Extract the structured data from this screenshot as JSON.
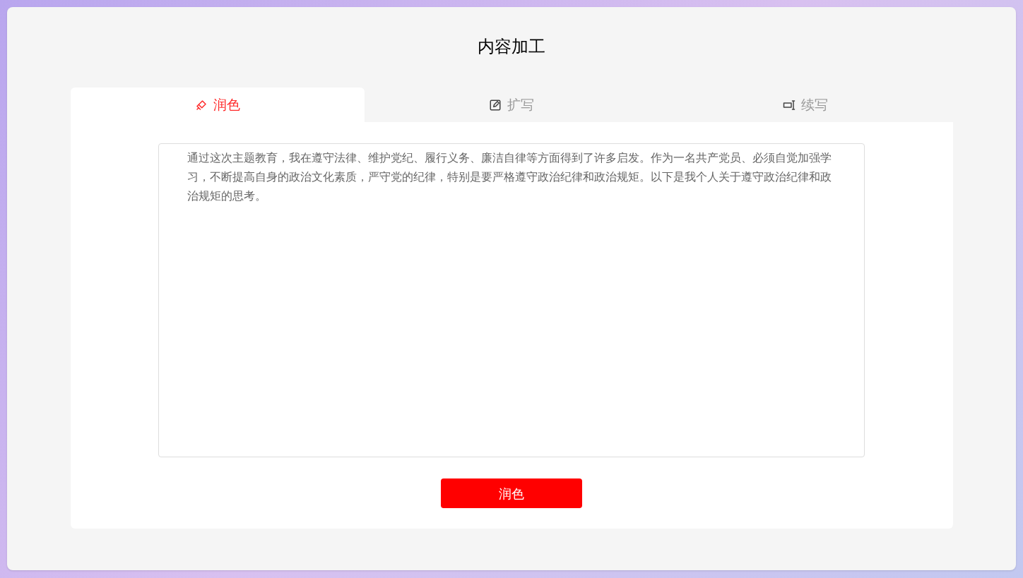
{
  "title": "内容加工",
  "tabs": [
    {
      "label": "润色",
      "kind": "brush",
      "selected": true
    },
    {
      "label": "扩写",
      "kind": "edit",
      "selected": false
    },
    {
      "label": "续写",
      "kind": "cursor",
      "selected": false
    }
  ],
  "editor": {
    "value": "通过这次主题教育，我在遵守法律、维护党纪、履行义务、廉洁自律等方面得到了许多启发。作为一名共产党员、必须自觉加强学习，不断提高自身的政治文化素质，严守党的纪律，特别是要严格遵守政治纪律和政治规矩。以下是我个人关于遵守政治纪律和政治规矩的思考。"
  },
  "submit_button": "润色"
}
